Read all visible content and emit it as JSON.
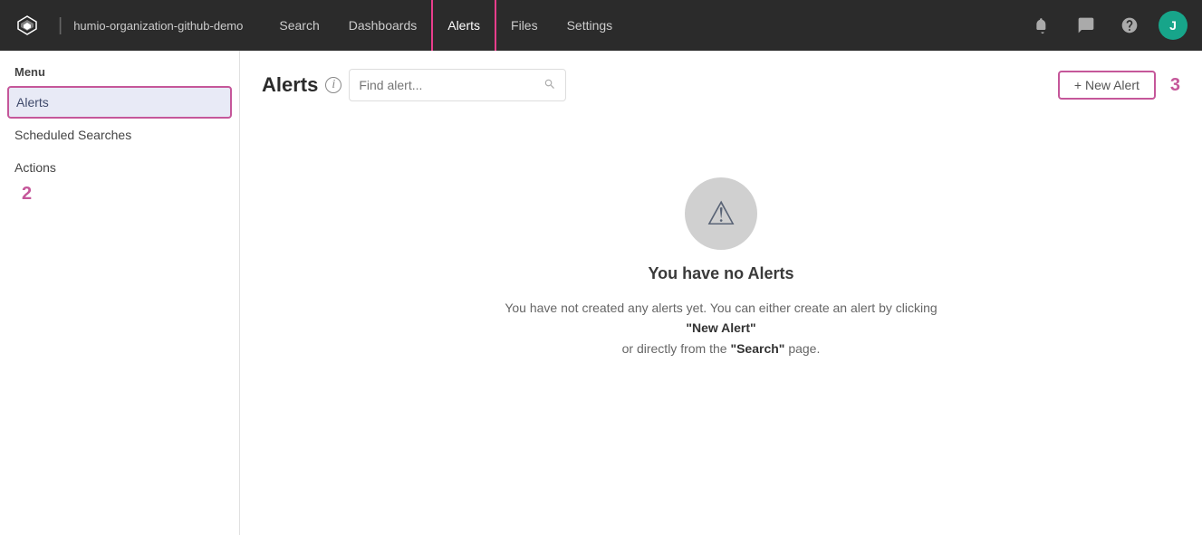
{
  "topnav": {
    "logo_alt": "Humio",
    "org_name": "humio-organization-github-demo",
    "links": [
      {
        "label": "Search",
        "active": false
      },
      {
        "label": "Dashboards",
        "active": false
      },
      {
        "label": "Alerts",
        "active": true
      },
      {
        "label": "Files",
        "active": false
      },
      {
        "label": "Settings",
        "active": false
      }
    ],
    "avatar_initial": "J"
  },
  "sidebar": {
    "menu_label": "Menu",
    "items": [
      {
        "label": "Alerts",
        "active": true
      },
      {
        "label": "Scheduled Searches",
        "active": false
      },
      {
        "label": "Actions",
        "active": false
      }
    ]
  },
  "main": {
    "page_title": "Alerts",
    "search_placeholder": "Find alert...",
    "new_alert_label": "+ New Alert",
    "step_numbers": {
      "sidebar": "2",
      "new_alert": "3"
    },
    "empty_state": {
      "title": "You have no Alerts",
      "desc_part1": "You have not created any alerts yet. You can either create an alert by clicking",
      "new_alert_link": "\"New Alert\"",
      "desc_part2": "or directly from the",
      "search_link": "\"Search\"",
      "desc_part3": "page."
    }
  }
}
